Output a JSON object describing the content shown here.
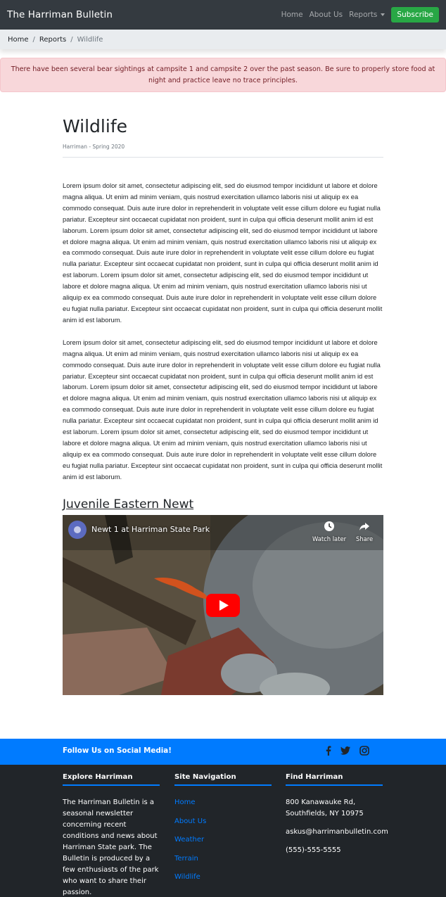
{
  "navbar": {
    "brand": "The Harriman Bulletin",
    "links": [
      "Home",
      "About Us",
      "Reports"
    ],
    "subscribe_label": "Subscribe"
  },
  "breadcrumb": {
    "home": "Home",
    "sep": "/",
    "reports": "Reports",
    "current": "Wildlife"
  },
  "alert": {
    "text": "There have been several bear sightings at campsite 1 and campsite 2 over the past season. Be sure to properly store food at night and practice leave no trace principles."
  },
  "article": {
    "title": "Wildlife",
    "subtitle": "Harriman - Spring 2020",
    "paragraphs": [
      "Lorem ipsum dolor sit amet, consectetur adipiscing elit, sed do eiusmod tempor incididunt ut labore et dolore magna aliqua. Ut enim ad minim veniam, quis nostrud exercitation ullamco laboris nisi ut aliquip ex ea commodo consequat. Duis aute irure dolor in reprehenderit in voluptate velit esse cillum dolore eu fugiat nulla pariatur. Excepteur sint occaecat cupidatat non proident, sunt in culpa qui officia deserunt mollit anim id est laborum. Lorem ipsum dolor sit amet, consectetur adipiscing elit, sed do eiusmod tempor incididunt ut labore et dolore magna aliqua. Ut enim ad minim veniam, quis nostrud exercitation ullamco laboris nisi ut aliquip ex ea commodo consequat. Duis aute irure dolor in reprehenderit in voluptate velit esse cillum dolore eu fugiat nulla pariatur. Excepteur sint occaecat cupidatat non proident, sunt in culpa qui officia deserunt mollit anim id est laborum. Lorem ipsum dolor sit amet, consectetur adipiscing elit, sed do eiusmod tempor incididunt ut labore et dolore magna aliqua. Ut enim ad minim veniam, quis nostrud exercitation ullamco laboris nisi ut aliquip ex ea commodo consequat. Duis aute irure dolor in reprehenderit in voluptate velit esse cillum dolore eu fugiat nulla pariatur. Excepteur sint occaecat cupidatat non proident, sunt in culpa qui officia deserunt mollit anim id est laborum.",
      "Lorem ipsum dolor sit amet, consectetur adipiscing elit, sed do eiusmod tempor incididunt ut labore et dolore magna aliqua. Ut enim ad minim veniam, quis nostrud exercitation ullamco laboris nisi ut aliquip ex ea commodo consequat. Duis aute irure dolor in reprehenderit in voluptate velit esse cillum dolore eu fugiat nulla pariatur. Excepteur sint occaecat cupidatat non proident, sunt in culpa qui officia deserunt mollit anim id est laborum. Lorem ipsum dolor sit amet, consectetur adipiscing elit, sed do eiusmod tempor incididunt ut labore et dolore magna aliqua. Ut enim ad minim veniam, quis nostrud exercitation ullamco laboris nisi ut aliquip ex ea commodo consequat. Duis aute irure dolor in reprehenderit in voluptate velit esse cillum dolore eu fugiat nulla pariatur. Excepteur sint occaecat cupidatat non proident, sunt in culpa qui officia deserunt mollit anim id est laborum. Lorem ipsum dolor sit amet, consectetur adipiscing elit, sed do eiusmod tempor incididunt ut labore et dolore magna aliqua. Ut enim ad minim veniam, quis nostrud exercitation ullamco laboris nisi ut aliquip ex ea commodo consequat. Duis aute irure dolor in reprehenderit in voluptate velit esse cillum dolore eu fugiat nulla pariatur. Excepteur sint occaecat cupidatat non proident, sunt in culpa qui officia deserunt mollit anim id est laborum."
    ],
    "section_title": "Juvenile Eastern Newt"
  },
  "video": {
    "title": "Newt 1 at Harriman State Park",
    "watch_later": "Watch later",
    "share": "Share"
  },
  "social": {
    "text": "Follow Us on Social Media!",
    "icons": [
      "facebook-icon",
      "twitter-icon",
      "instagram-icon"
    ]
  },
  "footer": {
    "explore": {
      "heading": "Explore Harriman",
      "text": "The Harriman Bulletin is a seasonal newsletter concerning recent conditions and news about Harriman State park. The Bulletin is produced by a few enthusiasts of the park who want to share their passion."
    },
    "site_nav": {
      "heading": "Site Navigation",
      "links": [
        "Home",
        "About Us",
        "Weather",
        "Terrain",
        "Wildlife"
      ]
    },
    "find": {
      "heading": "Find Harriman",
      "address_line1": "800 Kanawauke Rd,",
      "address_line2": "Southfields, NY 10975",
      "email": "askus@harrimanbulletin.com",
      "phone": "(555)-555-5555"
    }
  },
  "colors": {
    "navbar_bg": "#343a40",
    "subscribe_bg": "#28a745",
    "alert_bg": "#f8d7da",
    "alert_text": "#721c24",
    "social_bar_bg": "#007bff",
    "footer_bg": "#212529",
    "link_blue": "#007bff"
  }
}
